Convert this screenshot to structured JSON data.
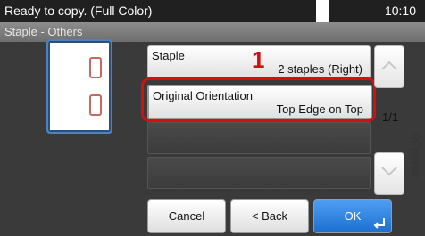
{
  "status": {
    "message": "Ready to copy. (Full Color)",
    "time": "10:10"
  },
  "screen_title": "Staple - Others",
  "options": [
    {
      "label": "Staple",
      "value": "2 staples (Right)"
    },
    {
      "label": "Original Orientation",
      "value": "Top Edge on Top"
    }
  ],
  "annotation": {
    "step": "1"
  },
  "pager": {
    "page": "1/1"
  },
  "buttons": {
    "cancel": "Cancel",
    "back": "< Back",
    "ok": "OK"
  },
  "figure_code": "2B0093_01",
  "colors": {
    "highlight": "#d21010",
    "ok_button": "#1c6fd0",
    "preview_border": "#4a82c2"
  }
}
